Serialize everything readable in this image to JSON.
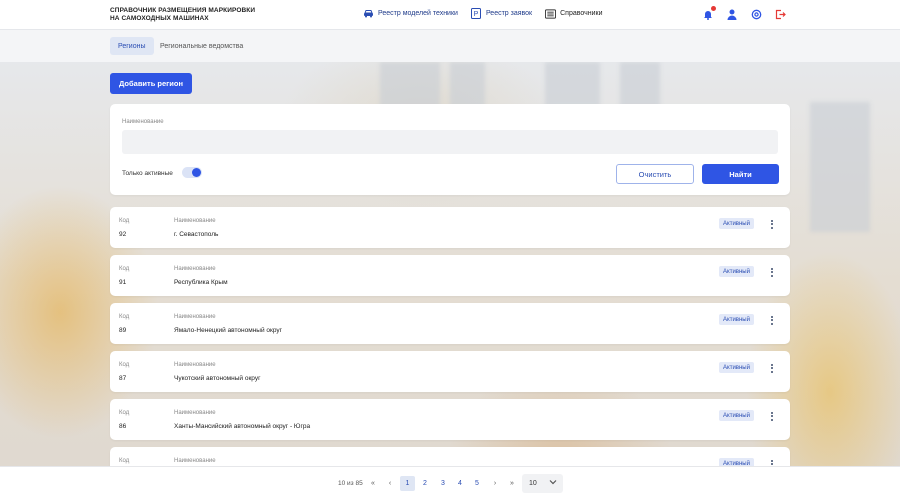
{
  "header": {
    "brand_line1": "СПРАВОЧНИК РАЗМЕЩЕНИЯ МАРКИРОВКИ",
    "brand_line2": "НА САМОХОДНЫХ МАШИНАХ",
    "nav": [
      {
        "label": "Реестр моделей техники",
        "icon": "car-icon"
      },
      {
        "label": "Реестр заявок",
        "icon": "document-p-icon"
      },
      {
        "label": "Справочники",
        "icon": "list-icon"
      }
    ],
    "icons": [
      "bell-icon",
      "user-icon",
      "settings-icon",
      "logout-icon"
    ]
  },
  "tabs": [
    {
      "label": "Регионы",
      "active": true
    },
    {
      "label": "Региональные ведомства",
      "active": false
    }
  ],
  "add_button": "Добавить регион",
  "filter": {
    "name_label": "Наименование",
    "name_value": "",
    "toggle_label": "Только активные",
    "toggle_on": true,
    "clear_label": "Очистить",
    "find_label": "Найти"
  },
  "columns": {
    "code": "Код",
    "name": "Наименование"
  },
  "rows": [
    {
      "code": "92",
      "name": "г. Севастополь",
      "status": "Активный"
    },
    {
      "code": "91",
      "name": "Республика Крым",
      "status": "Активный"
    },
    {
      "code": "89",
      "name": "Ямало-Ненецкий автономный округ",
      "status": "Активный"
    },
    {
      "code": "87",
      "name": "Чукотский автономный округ",
      "status": "Активный"
    },
    {
      "code": "86",
      "name": "Ханты-Мансийский автономный округ - Югра",
      "status": "Активный"
    },
    {
      "code": "",
      "name": "",
      "status": "Активный"
    }
  ],
  "pagination": {
    "info": "10 из 85",
    "first": "«",
    "prev": "‹",
    "pages": [
      "1",
      "2",
      "3",
      "4",
      "5"
    ],
    "current": "1",
    "next": "›",
    "last": "»",
    "page_size": "10"
  },
  "colors": {
    "accent": "#2f55e4",
    "badge_bg": "#e3e9f8",
    "alert": "#e53935"
  }
}
